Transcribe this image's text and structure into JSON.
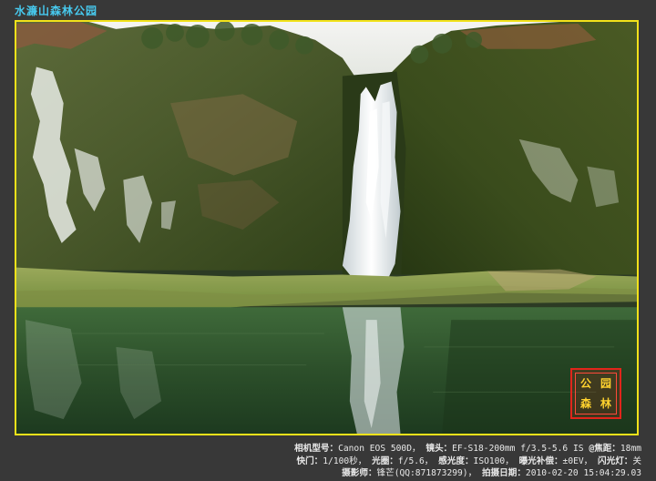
{
  "page": {
    "title": "水濂山森林公园"
  },
  "photo": {
    "subject": "waterfall-and-lake",
    "frame_color": "#f2e21a",
    "title_color": "#47c9ee"
  },
  "seal": {
    "chars": [
      "公",
      "园",
      "森",
      "林"
    ],
    "color": "#e1251b"
  },
  "exif": {
    "line1": {
      "camera_label": "相机型号：",
      "camera_value": "Canon EOS 500D，",
      "lens_label": "镜头：",
      "lens_value": "EF-S18-200mm f/3.5-5.6 IS ",
      "focal_label": "@焦距：",
      "focal_value": "18mm"
    },
    "line2": {
      "shutter_label": "快门：",
      "shutter_value": "1/100秒，",
      "aperture_label": "光圈：",
      "aperture_value": "f/5.6，",
      "iso_label": "感光度：",
      "iso_value": "ISO100，",
      "ev_label": "曝光补偿：",
      "ev_value": "±0EV，",
      "flash_label": "闪光灯：",
      "flash_value": "关"
    },
    "line3": {
      "photographer_label": "摄影师：",
      "photographer_value": "锋芒(QQ:871873299)，",
      "date_label": "拍摄日期：",
      "date_value": "2010-02-20 15:04:29.03"
    }
  }
}
